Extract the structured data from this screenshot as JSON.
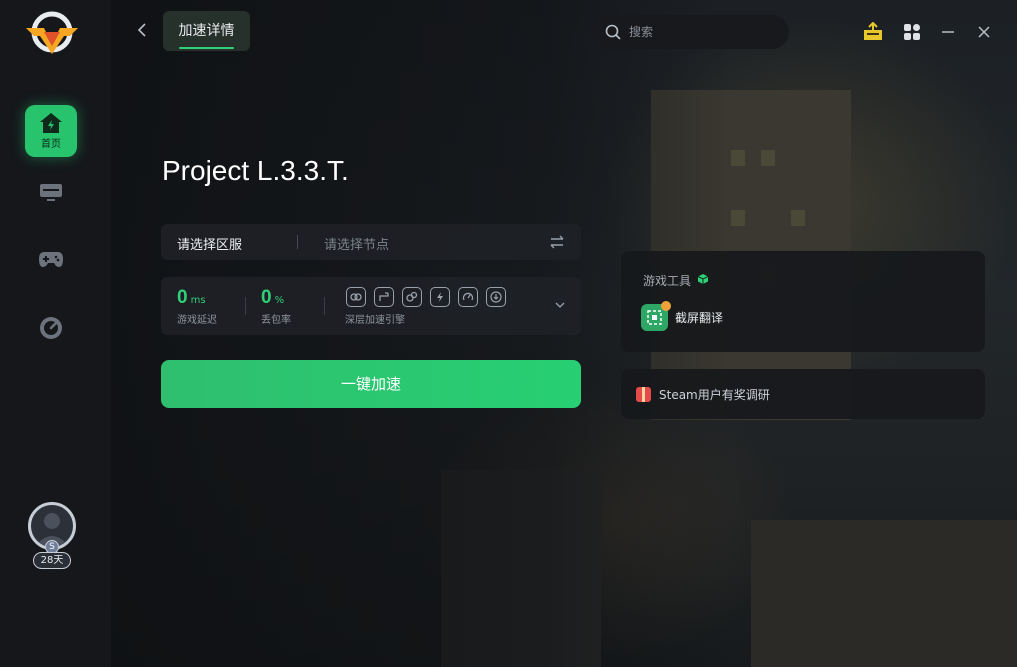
{
  "sidebar": {
    "items": [
      {
        "name": "home",
        "label": "首页",
        "icon": "home-icon",
        "active": true
      },
      {
        "name": "monitor",
        "label": "",
        "icon": "monitor-icon",
        "active": false
      },
      {
        "name": "gamepad",
        "label": "",
        "icon": "gamepad-icon",
        "active": false
      },
      {
        "name": "speed",
        "label": "",
        "icon": "speedometer-icon",
        "active": false
      }
    ],
    "user": {
      "level_badge": "S",
      "days": "28天"
    }
  },
  "header": {
    "tab_label": "加速详情",
    "search_placeholder": "搜索"
  },
  "game": {
    "title": "Project L.3.3.T."
  },
  "region": {
    "server_label": "请选择区服",
    "node_placeholder": "请选择节点"
  },
  "stats": {
    "latency": {
      "value": "0",
      "unit": "ms",
      "label": "游戏延迟"
    },
    "packet_loss": {
      "value": "0",
      "unit": "%",
      "label": "丢包率"
    },
    "engine_label": "深层加速引擎"
  },
  "accelerate_button": "一键加速",
  "tools": {
    "title": "游戏工具",
    "items": [
      {
        "label": "截屏翻译",
        "icon": "screenshot-translate-icon"
      }
    ]
  },
  "survey": {
    "label": "Steam用户有奖调研"
  },
  "colors": {
    "accent": "#27c46d",
    "sidebar_bg": "#15171b"
  }
}
